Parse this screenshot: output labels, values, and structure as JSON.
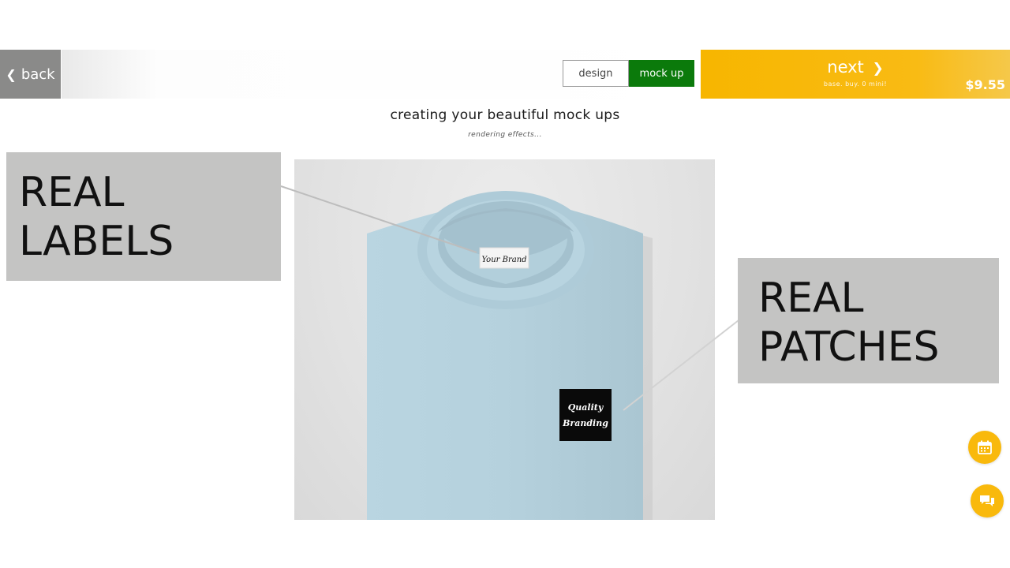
{
  "topbar": {
    "back_label": "back",
    "tabs": [
      {
        "label": "design",
        "active": false
      },
      {
        "label": "mock up",
        "active": true
      }
    ],
    "next": {
      "label": "next",
      "sublabel": "base. buy. 0 mini!",
      "price": "$9.55"
    }
  },
  "main": {
    "headline": "creating your beautiful mock ups",
    "subline": "rendering effects..."
  },
  "mockup": {
    "label_text": "Your Brand",
    "patch_line1": "Quality",
    "patch_line2": "Branding",
    "shirt_color": "#b6d3df"
  },
  "callouts": {
    "labels": {
      "line1": "REAL",
      "line2": "LABELS"
    },
    "patches": {
      "line1": "REAL",
      "line2": "PATCHES"
    }
  },
  "fabs": {
    "calendar_icon": "calendar-icon",
    "chat_icon": "chat-icon"
  },
  "colors": {
    "accent_yellow": "#f9b90c",
    "active_green": "#0b7a0b",
    "back_grey": "#8a8a89",
    "callout_grey": "#c4c4c3"
  }
}
